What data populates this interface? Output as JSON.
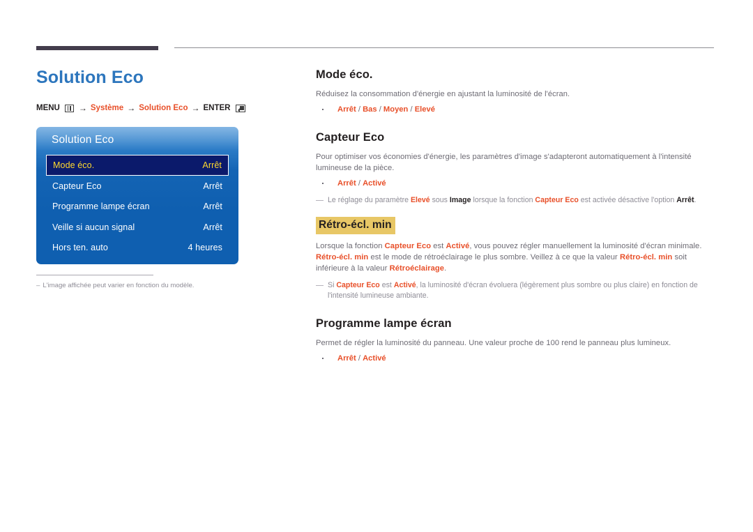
{
  "document": {
    "page_title": "Solution Eco",
    "breadcrumb": {
      "menu_label": "MENU",
      "menu_icon": "menu-grid-icon",
      "arrow": "→",
      "step1": "Système",
      "step2": "Solution Eco",
      "enter_label": "ENTER",
      "enter_icon": "enter-return-icon"
    },
    "footnote": {
      "dash": "–",
      "text": "L'image affichée peut varier en fonction du modèle."
    }
  },
  "osd": {
    "title": "Solution Eco",
    "rows": [
      {
        "label": "Mode éco.",
        "value": "Arrêt",
        "selected": true
      },
      {
        "label": "Capteur Eco",
        "value": "Arrêt",
        "selected": false
      },
      {
        "label": "Programme lampe écran",
        "value": "Arrêt",
        "selected": false
      },
      {
        "label": "Veille si aucun signal",
        "value": "Arrêt",
        "selected": false
      },
      {
        "label": "Hors ten. auto",
        "value": "4 heures",
        "selected": false
      }
    ]
  },
  "sections": {
    "mode_eco": {
      "heading": "Mode éco.",
      "body": "Réduisez la consommation d'énergie en ajustant la luminosité de l'écran.",
      "option_1": "Arrêt",
      "sep_1": " / ",
      "option_2": "Bas",
      "sep_2": " / ",
      "option_3": "Moyen",
      "sep_3": " / ",
      "option_4": "Elevé"
    },
    "capteur_eco": {
      "heading": "Capteur Eco",
      "body": "Pour optimiser vos économies d'énergie, les paramètres d'image s'adapteront automatiquement à l'intensité lumineuse de la pièce.",
      "option_1": "Arrêt",
      "sep_1": " / ",
      "option_2": "Activé",
      "note_t1": "Le réglage du paramètre ",
      "note_b1": "Elevé",
      "note_t2": " sous ",
      "note_b2": "Image",
      "note_t3": " lorsque la fonction ",
      "note_b3": "Capteur Eco",
      "note_t4": " est activée désactive l'option ",
      "note_b4": "Arrêt",
      "note_t5": "."
    },
    "retro_ecl_min": {
      "heading": "Rétro-écl. min",
      "p1_t1": "Lorsque la fonction ",
      "p1_b1": "Capteur Eco",
      "p1_t2": " est ",
      "p1_b2": "Activé",
      "p1_t3": ", vous pouvez régler manuellement la luminosité d'écran minimale. ",
      "p1_b3": "Rétro-écl. min",
      "p1_t4": " est le mode de rétroéclairage le plus sombre. Veillez à ce que la valeur ",
      "p1_b4": "Rétro-écl. min",
      "p1_t5": " soit inférieure à la valeur ",
      "p1_b5": "Rétroéclairage",
      "p1_t6": ".",
      "note_t1": "Si ",
      "note_b1": "Capteur Eco",
      "note_t2": " est ",
      "note_b2": "Activé",
      "note_t3": ", la luminosité d'écran évoluera (légèrement plus sombre ou plus claire) en fonction de l'intensité lumineuse ambiante."
    },
    "programme_lampe": {
      "heading": "Programme lampe écran",
      "body": "Permet de régler la luminosité du panneau. Une valeur proche de 100 rend le panneau plus lumineux.",
      "option_1": "Arrêt",
      "sep_1": " / ",
      "option_2": "Activé"
    }
  },
  "colors": {
    "accent_blue": "#2d76bd",
    "accent_orange": "#e8502a",
    "highlight_gold": "#e8c766",
    "osd_blue": "#0f5fb0",
    "osd_selected_bg": "#0b1a6b",
    "osd_selected_text": "#ffd92e"
  }
}
